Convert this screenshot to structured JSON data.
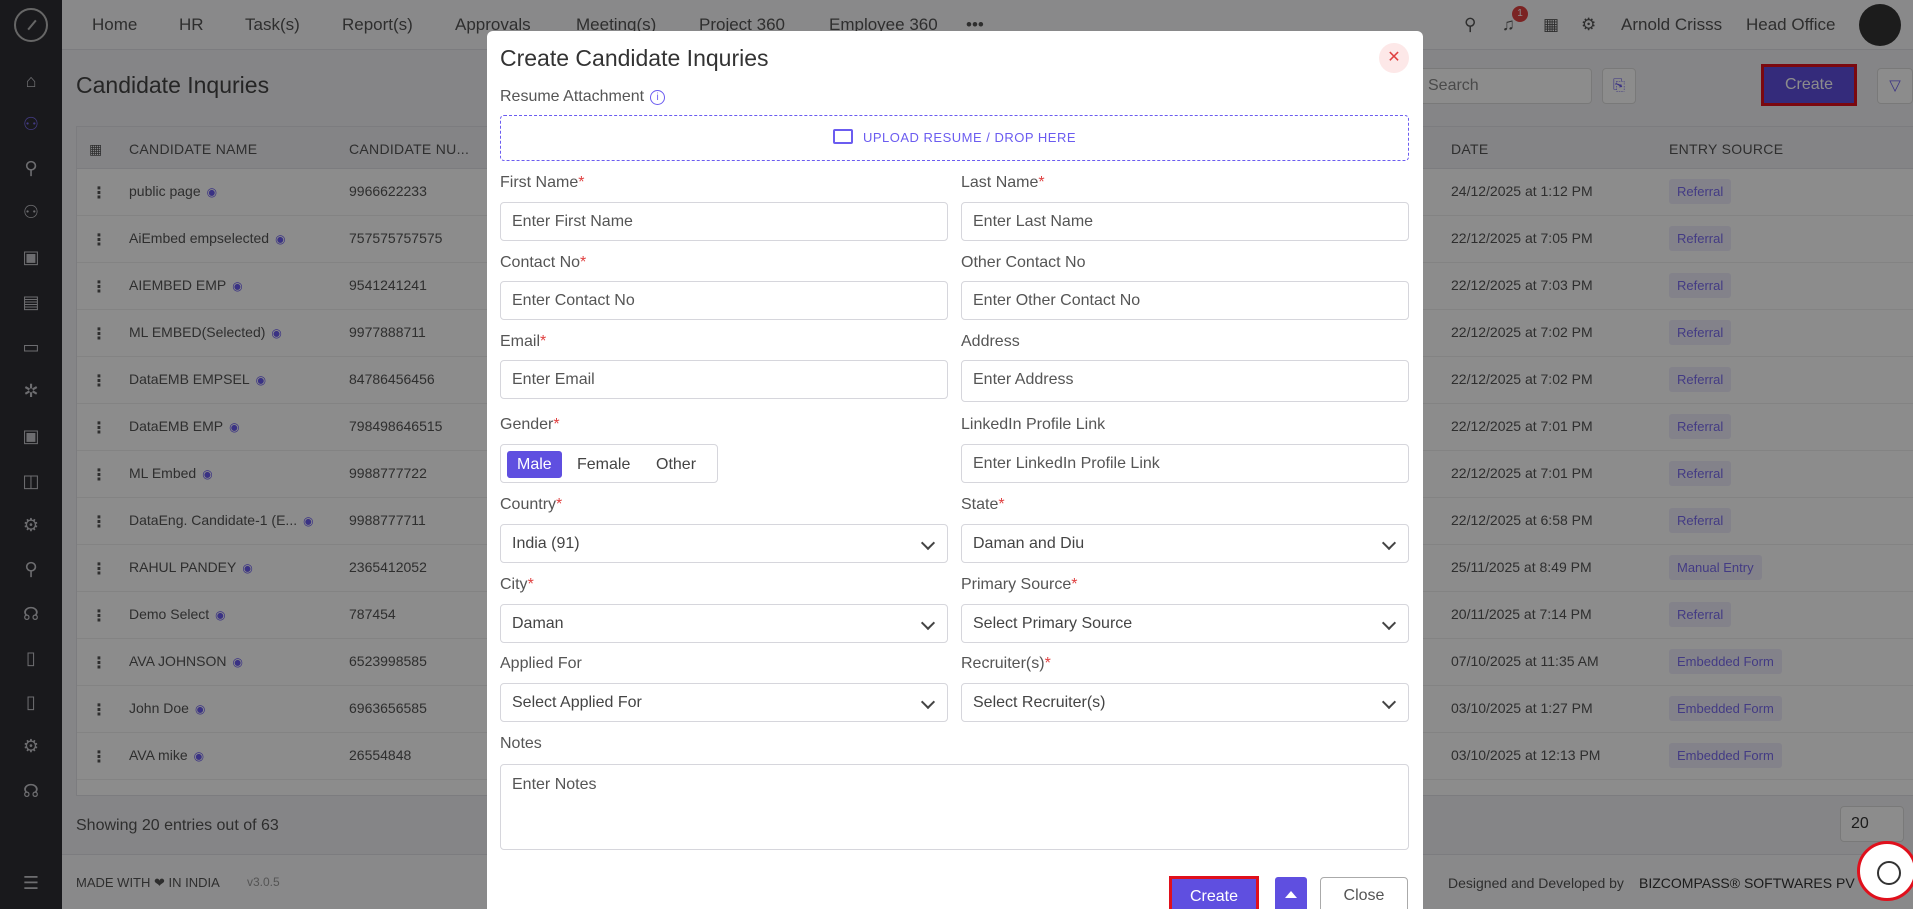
{
  "nav": {
    "items": [
      "Home",
      "HR",
      "Task(s)",
      "Report(s)",
      "Approvals",
      "Meeting(s)",
      "Project 360",
      "Employee 360"
    ],
    "more": "•••",
    "user": "Arnold Crisss",
    "office": "Head Office",
    "notif_count": "1"
  },
  "page": {
    "title": "Candidate Inquries",
    "search_placeholder": "Search",
    "create": "Create",
    "showing": "Showing 20 entries out of 63",
    "page_size": "20",
    "made_with": "MADE WITH ❤ IN INDIA",
    "version": "v3.0.5",
    "designed": "Designed and Developed by",
    "company": "BIZCOMPASS® SOFTWARES PV"
  },
  "table": {
    "headers": [
      "CANDIDATE NAME",
      "CANDIDATE NU...",
      "DATE",
      "ENTRY SOURCE"
    ],
    "rows": [
      {
        "name": "public page",
        "num": "9966622233",
        "date": "24/12/2025 at 1:12 PM",
        "src": "Referral"
      },
      {
        "name": "AiEmbed empselected",
        "num": "757575757575",
        "date": "22/12/2025 at 7:05 PM",
        "src": "Referral"
      },
      {
        "name": "AIEMBED EMP",
        "num": "9541241241",
        "date": "22/12/2025 at 7:03 PM",
        "src": "Referral"
      },
      {
        "name": "ML EMBED(Selected)",
        "num": "9977888711",
        "date": "22/12/2025 at 7:02 PM",
        "src": "Referral"
      },
      {
        "name": "DataEMB EMPSEL",
        "num": "84786456456",
        "date": "22/12/2025 at 7:02 PM",
        "src": "Referral"
      },
      {
        "name": "DataEMB EMP",
        "num": "798498646515",
        "date": "22/12/2025 at 7:01 PM",
        "src": "Referral"
      },
      {
        "name": "ML Embed",
        "num": "9988777722",
        "date": "22/12/2025 at 7:01 PM",
        "src": "Referral"
      },
      {
        "name": "DataEng. Candidate-1 (E...",
        "num": "9988777711",
        "date": "22/12/2025 at 6:58 PM",
        "src": "Referral"
      },
      {
        "name": "RAHUL PANDEY",
        "num": "2365412052",
        "date": "25/11/2025 at 8:49 PM",
        "src": "Manual Entry"
      },
      {
        "name": "Demo Select",
        "num": "787454",
        "date": "20/11/2025 at 7:14 PM",
        "src": "Referral"
      },
      {
        "name": "AVA JOHNSON",
        "num": "6523998585",
        "date": "07/10/2025 at 11:35 AM",
        "src": "Embedded Form"
      },
      {
        "name": "John Doe",
        "num": "6963656585",
        "date": "03/10/2025 at 1:27 PM",
        "src": "Embedded Form"
      },
      {
        "name": "AVA mike",
        "num": "26554848",
        "date": "03/10/2025 at 12:13 PM",
        "src": "Embedded Form"
      }
    ]
  },
  "modal": {
    "title": "Create Candidate Inquries",
    "resume_label": "Resume Attachment",
    "upload": "UPLOAD RESUME / DROP HERE",
    "first_name": {
      "label": "First Name",
      "placeholder": "Enter First Name"
    },
    "last_name": {
      "label": "Last Name",
      "placeholder": "Enter Last Name"
    },
    "contact": {
      "label": "Contact No",
      "placeholder": "Enter Contact No"
    },
    "other_contact": {
      "label": "Other Contact No",
      "placeholder": "Enter Other Contact No"
    },
    "email": {
      "label": "Email",
      "placeholder": "Enter Email"
    },
    "address": {
      "label": "Address",
      "placeholder": "Enter Address"
    },
    "gender": {
      "label": "Gender",
      "options": [
        "Male",
        "Female",
        "Other"
      ],
      "selected": "Male"
    },
    "linkedin": {
      "label": "LinkedIn Profile Link",
      "placeholder": "Enter LinkedIn Profile Link"
    },
    "country": {
      "label": "Country",
      "value": "India (91)"
    },
    "state": {
      "label": "State",
      "value": "Daman and Diu"
    },
    "city": {
      "label": "City",
      "value": "Daman"
    },
    "primary_source": {
      "label": "Primary Source",
      "value": "Select Primary Source"
    },
    "applied_for": {
      "label": "Applied For",
      "value": "Select Applied For"
    },
    "recruiters": {
      "label": "Recruiter(s)",
      "value": "Select Recruiter(s)"
    },
    "notes": {
      "label": "Notes",
      "placeholder": "Enter Notes"
    },
    "create": "Create",
    "close": "Close"
  },
  "colors": {
    "accent": "#5f4fe0",
    "highlight": "#e0101c",
    "sidebar": "#2f2f34"
  }
}
